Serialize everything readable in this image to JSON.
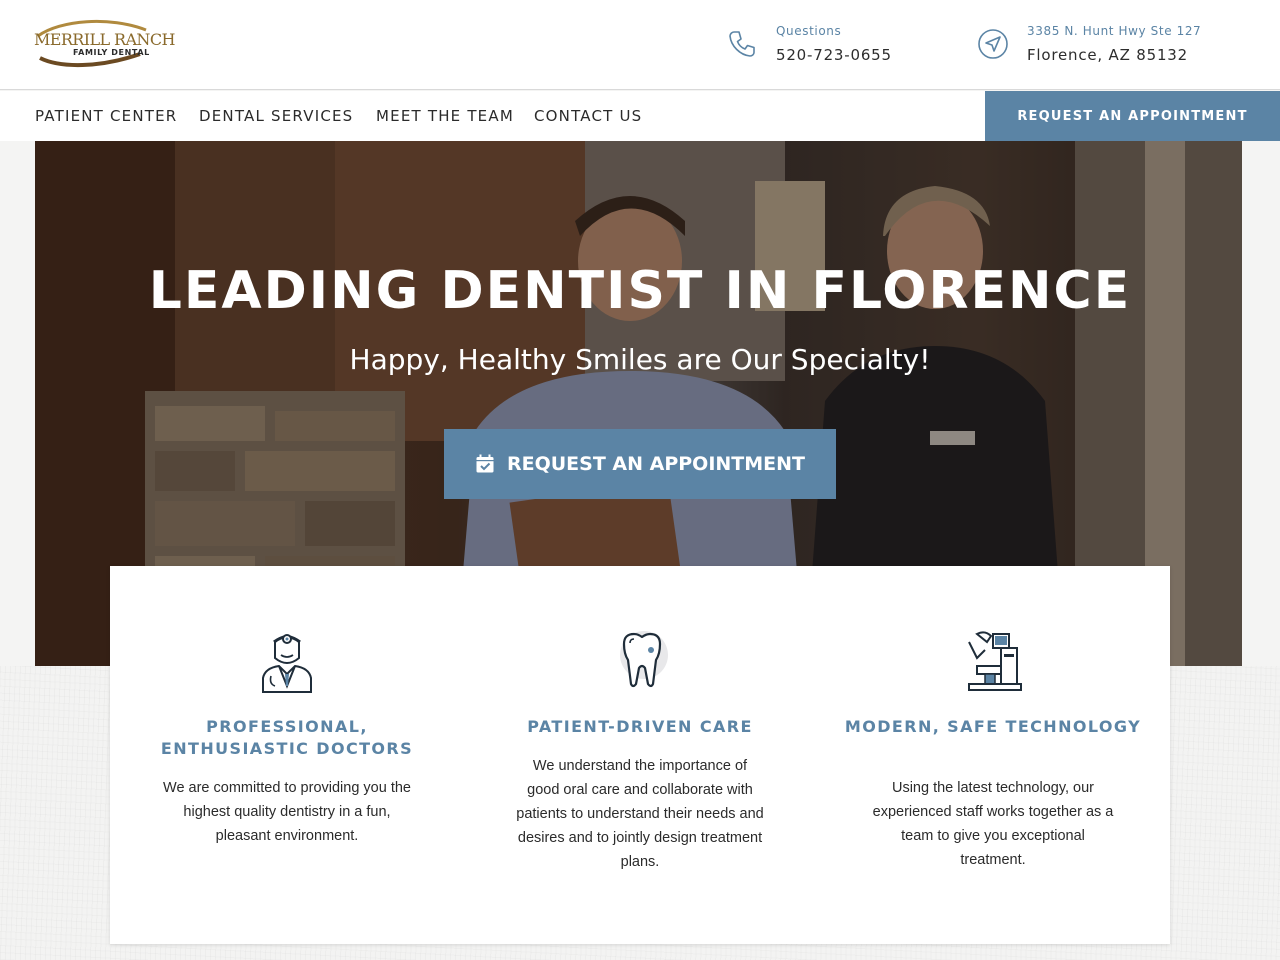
{
  "header": {
    "logo": {
      "name": "MERRILL RANCH",
      "sub": "FAMILY DENTAL"
    },
    "phone": {
      "label": "Questions",
      "value": "520-723-0655",
      "icon": "phone-icon"
    },
    "address": {
      "label": "3385 N. Hunt Hwy Ste 127",
      "value": "Florence, AZ 85132",
      "icon": "location-arrow-icon"
    }
  },
  "nav": {
    "items": [
      {
        "label": "PATIENT CENTER"
      },
      {
        "label": "DENTAL SERVICES"
      },
      {
        "label": "MEET THE TEAM"
      },
      {
        "label": "CONTACT US"
      }
    ],
    "cta_label": "REQUEST AN APPOINTMENT"
  },
  "hero": {
    "title": "LEADING DENTIST IN FLORENCE",
    "subtitle": "Happy, Healthy Smiles are Our Specialty!",
    "cta_label": "REQUEST AN APPOINTMENT",
    "cta_icon": "calendar-check-icon"
  },
  "features": [
    {
      "icon": "dentist-icon",
      "title": "PROFESSIONAL, ENTHUSIASTIC DOCTORS",
      "text": "We are committed to providing you the highest quality dentistry in a fun, pleasant environment."
    },
    {
      "icon": "tooth-icon",
      "title": "PATIENT-DRIVEN CARE",
      "text": "We understand the importance of good oral care and collaborate with patients to understand their needs and desires and to jointly design treatment plans."
    },
    {
      "icon": "dental-chair-icon",
      "title": "MODERN, SAFE TECHNOLOGY",
      "text": "Using the latest technology, our experienced staff works together as a team to give you exceptional treatment."
    }
  ],
  "colors": {
    "accent": "#5b84a5",
    "text": "#2b2b2b",
    "logo_gold": "#8a6a2c"
  }
}
